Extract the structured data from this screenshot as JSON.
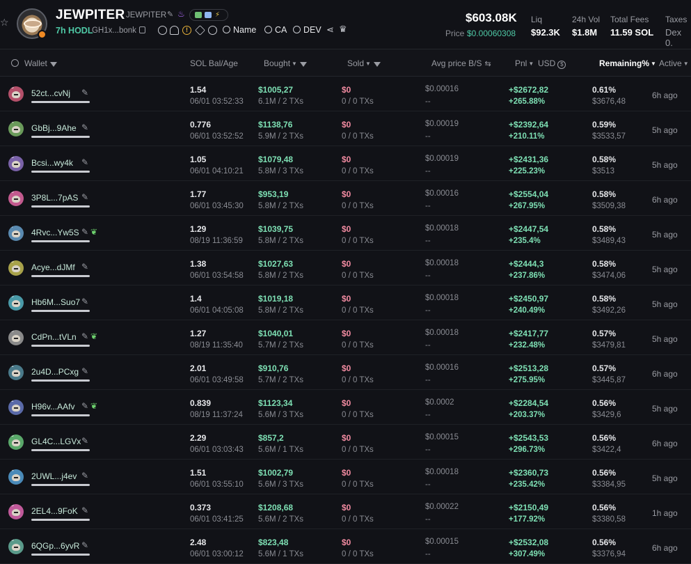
{
  "token": {
    "name": "JEWPITER",
    "symbol": "JEWPITER",
    "hodl": "7h HODL",
    "ca_short": "GH1x...bonk",
    "search_buttons": [
      "Name",
      "CA",
      "DEV"
    ]
  },
  "stats": {
    "market_cap": "$603.08K",
    "price_label": "Price",
    "price_value": "$0.00060308",
    "liq_label": "Liq",
    "liq_value": "$92.3K",
    "vol_label": "24h Vol",
    "vol_value": "$1.8M",
    "fees_label": "Total Fees",
    "fees_value": "11.59 SOL",
    "taxes_label": "Taxes",
    "taxes_value": "Dex 0."
  },
  "columns": {
    "wallet": "Wallet",
    "sol_bal": "SOL Bal/Age",
    "bought": "Bought",
    "sold": "Sold",
    "avg_price": "Avg price B/S",
    "pnl": "Pnl",
    "usd": "USD",
    "remaining": "Remaining%",
    "active": "Active"
  },
  "rows": [
    {
      "n": "13",
      "color": "#b4506a",
      "wallet": "52ct...cvNj",
      "leaf": false,
      "sol": "1.54",
      "date": "06/01 03:52:33",
      "bought": "$1005,27",
      "bought_sub": "6.1M / 2 TXs",
      "sold": "$0",
      "sold_sub": "0 / 0 TXs",
      "avg": "$0.00016",
      "avg_sub": "--",
      "pnl": "+$2672,82",
      "pnl_pct": "+265.88%",
      "rem": "0.61%",
      "rem_usd": "$3676,48",
      "age": "6h ago"
    },
    {
      "n": "14",
      "color": "#6a9a5a",
      "wallet": "GbBj...9Ahe",
      "leaf": false,
      "sol": "0.776",
      "date": "06/01 03:52:52",
      "bought": "$1138,76",
      "bought_sub": "5.9M / 2 TXs",
      "sold": "$0",
      "sold_sub": "0 / 0 TXs",
      "avg": "$0.00019",
      "avg_sub": "--",
      "pnl": "+$2392,64",
      "pnl_pct": "+210.11%",
      "rem": "0.59%",
      "rem_usd": "$3533,57",
      "age": "5h ago"
    },
    {
      "n": "15",
      "color": "#7a62a8",
      "wallet": "Bcsi...wy4k",
      "leaf": false,
      "sol": "1.05",
      "date": "06/01 04:10:21",
      "bought": "$1079,48",
      "bought_sub": "5.8M / 3 TXs",
      "sold": "$0",
      "sold_sub": "0 / 0 TXs",
      "avg": "$0.00019",
      "avg_sub": "--",
      "pnl": "+$2431,36",
      "pnl_pct": "+225.23%",
      "rem": "0.58%",
      "rem_usd": "$3513",
      "age": "5h ago"
    },
    {
      "n": "16",
      "color": "#c25a8e",
      "wallet": "3P8L...7pAS",
      "leaf": false,
      "sol": "1.77",
      "date": "06/01 03:45:30",
      "bought": "$953,19",
      "bought_sub": "5.8M / 2 TXs",
      "sold": "$0",
      "sold_sub": "0 / 0 TXs",
      "avg": "$0.00016",
      "avg_sub": "--",
      "pnl": "+$2554,04",
      "pnl_pct": "+267.95%",
      "rem": "0.58%",
      "rem_usd": "$3509,38",
      "age": "6h ago"
    },
    {
      "n": "17",
      "color": "#5a8ab0",
      "wallet": "4Rvc...Yw5S",
      "leaf": true,
      "sol": "1.29",
      "date": "08/19 11:36:59",
      "bought": "$1039,75",
      "bought_sub": "5.8M / 2 TXs",
      "sold": "$0",
      "sold_sub": "0 / 0 TXs",
      "avg": "$0.00018",
      "avg_sub": "--",
      "pnl": "+$2447,54",
      "pnl_pct": "+235.4%",
      "rem": "0.58%",
      "rem_usd": "$3489,43",
      "age": "5h ago"
    },
    {
      "n": "18",
      "color": "#a8a24a",
      "wallet": "Acye...dJMf",
      "leaf": false,
      "sol": "1.38",
      "date": "06/01 03:54:58",
      "bought": "$1027,63",
      "bought_sub": "5.8M / 2 TXs",
      "sold": "$0",
      "sold_sub": "0 / 0 TXs",
      "avg": "$0.00018",
      "avg_sub": "--",
      "pnl": "+$2444,3",
      "pnl_pct": "+237.86%",
      "rem": "0.58%",
      "rem_usd": "$3474,06",
      "age": "5h ago"
    },
    {
      "n": "19",
      "color": "#4a9aa8",
      "wallet": "Hb6M...Suo7",
      "leaf": false,
      "sol": "1.4",
      "date": "06/01 04:05:08",
      "bought": "$1019,18",
      "bought_sub": "5.8M / 2 TXs",
      "sold": "$0",
      "sold_sub": "0 / 0 TXs",
      "avg": "$0.00018",
      "avg_sub": "--",
      "pnl": "+$2450,97",
      "pnl_pct": "+240.49%",
      "rem": "0.58%",
      "rem_usd": "$3492,26",
      "age": "5h ago"
    },
    {
      "n": "20",
      "color": "#8a8a8a",
      "wallet": "CdPn...tVLn",
      "leaf": true,
      "sol": "1.27",
      "date": "08/19 11:35:40",
      "bought": "$1040,01",
      "bought_sub": "5.7M / 2 TXs",
      "sold": "$0",
      "sold_sub": "0 / 0 TXs",
      "avg": "$0.00018",
      "avg_sub": "--",
      "pnl": "+$2417,77",
      "pnl_pct": "+232.48%",
      "rem": "0.57%",
      "rem_usd": "$3479,81",
      "age": "5h ago"
    },
    {
      "n": "21",
      "color": "#4a7a8a",
      "wallet": "2u4D...PCxg",
      "leaf": false,
      "sol": "2.01",
      "date": "06/01 03:49:58",
      "bought": "$910,76",
      "bought_sub": "5.7M / 2 TXs",
      "sold": "$0",
      "sold_sub": "0 / 0 TXs",
      "avg": "$0.00016",
      "avg_sub": "--",
      "pnl": "+$2513,28",
      "pnl_pct": "+275.95%",
      "rem": "0.57%",
      "rem_usd": "$3445,87",
      "age": "6h ago"
    },
    {
      "n": "22",
      "color": "#5a6aa8",
      "wallet": "H96v...AAfv",
      "leaf": true,
      "sol": "0.839",
      "date": "08/19 11:37:24",
      "bought": "$1123,34",
      "bought_sub": "5.6M / 3 TXs",
      "sold": "$0",
      "sold_sub": "0 / 0 TXs",
      "avg": "$0.0002",
      "avg_sub": "--",
      "pnl": "+$2284,54",
      "pnl_pct": "+203.37%",
      "rem": "0.56%",
      "rem_usd": "$3429,6",
      "age": "5h ago"
    },
    {
      "n": "23",
      "color": "#5aa86a",
      "wallet": "GL4C...LGVx",
      "leaf": false,
      "sol": "2.29",
      "date": "06/01 03:03:43",
      "bought": "$857,2",
      "bought_sub": "5.6M / 1 TXs",
      "sold": "$0",
      "sold_sub": "0 / 0 TXs",
      "avg": "$0.00015",
      "avg_sub": "--",
      "pnl": "+$2543,53",
      "pnl_pct": "+296.73%",
      "rem": "0.56%",
      "rem_usd": "$3422,4",
      "age": "6h ago"
    },
    {
      "n": "24",
      "color": "#4a8ab8",
      "wallet": "2UWL...j4ev",
      "leaf": false,
      "sol": "1.51",
      "date": "06/01 03:55:10",
      "bought": "$1002,79",
      "bought_sub": "5.6M / 3 TXs",
      "sold": "$0",
      "sold_sub": "0 / 0 TXs",
      "avg": "$0.00018",
      "avg_sub": "--",
      "pnl": "+$2360,73",
      "pnl_pct": "+235.42%",
      "rem": "0.56%",
      "rem_usd": "$3384,95",
      "age": "5h ago"
    },
    {
      "n": "25",
      "color": "#c05a9a",
      "wallet": "2EL4...9FoK",
      "leaf": false,
      "sol": "0.373",
      "date": "06/01 03:41:25",
      "bought": "$1208,68",
      "bought_sub": "5.6M / 2 TXs",
      "sold": "$0",
      "sold_sub": "0 / 0 TXs",
      "avg": "$0.00022",
      "avg_sub": "--",
      "pnl": "+$2150,49",
      "pnl_pct": "+177.92%",
      "rem": "0.56%",
      "rem_usd": "$3380,58",
      "age": "1h ago"
    },
    {
      "n": "26",
      "color": "#5a9a8a",
      "wallet": "6QGp...6yvR",
      "leaf": false,
      "sol": "2.48",
      "date": "06/01 03:00:12",
      "bought": "$823,48",
      "bought_sub": "5.6M / 1 TXs",
      "sold": "$0",
      "sold_sub": "0 / 0 TXs",
      "avg": "$0.00015",
      "avg_sub": "--",
      "pnl": "+$2532,08",
      "pnl_pct": "+307.49%",
      "rem": "0.56%",
      "rem_usd": "$3376,94",
      "age": "6h ago"
    }
  ]
}
